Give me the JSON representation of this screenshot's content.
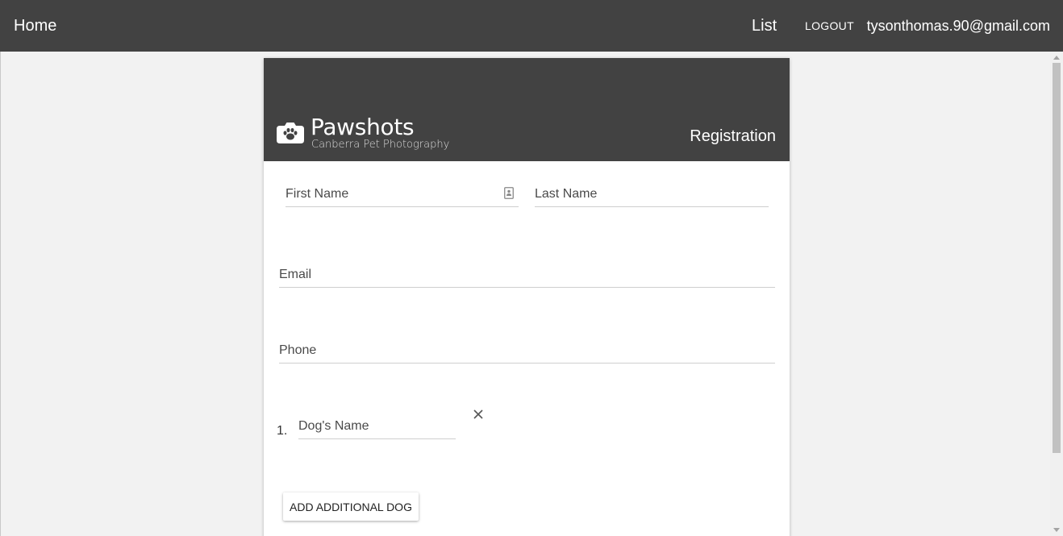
{
  "topbar": {
    "home_label": "Home",
    "list_label": "List",
    "logout_label": "LOGOUT",
    "user_email": "tysonthomas.90@gmail.com"
  },
  "brand": {
    "name": "Pawshots",
    "tagline": "Canberra Pet Photography",
    "icon": "camera-paw-icon"
  },
  "page": {
    "title": "Registration"
  },
  "form": {
    "first_name": {
      "placeholder": "First Name",
      "value": "",
      "icon": "contact-card-icon"
    },
    "last_name": {
      "placeholder": "Last Name",
      "value": ""
    },
    "email": {
      "placeholder": "Email",
      "value": ""
    },
    "phone": {
      "placeholder": "Phone",
      "value": ""
    },
    "dogs": [
      {
        "index": "1.",
        "placeholder": "Dog's Name",
        "value": "",
        "remove_icon": "close-icon"
      }
    ],
    "add_dog_label": "ADD ADDITIONAL DOG"
  },
  "colors": {
    "header_bg": "#424242",
    "page_bg": "#f2f2f2",
    "card_bg": "#ffffff",
    "header_text": "#ffffff"
  }
}
